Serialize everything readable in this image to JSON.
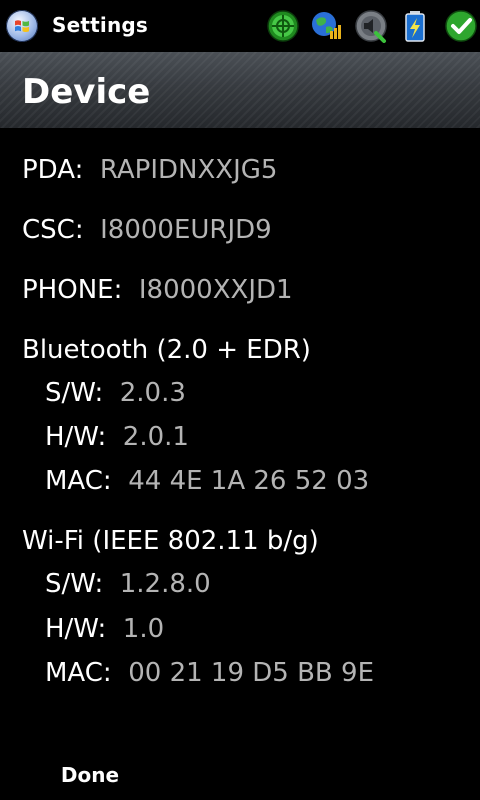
{
  "statusbar": {
    "app_title": "Settings",
    "icons": [
      "start-icon",
      "connectivity-icon",
      "data-connection-icon",
      "volume-icon",
      "battery-icon",
      "ok-icon"
    ]
  },
  "header": {
    "title": "Device"
  },
  "device": {
    "pda_label": "PDA:",
    "pda_value": "RAPIDNXXJG5",
    "csc_label": "CSC:",
    "csc_value": "I8000EURJD9",
    "phone_label": "PHONE:",
    "phone_value": "I8000XXJD1"
  },
  "bluetooth": {
    "title": "Bluetooth (2.0 + EDR)",
    "sw_label": "S/W:",
    "sw_value": "2.0.3",
    "hw_label": "H/W:",
    "hw_value": "2.0.1",
    "mac_label": "MAC:",
    "mac_value": "44 4E 1A 26 52 03"
  },
  "wifi": {
    "title": "Wi-Fi (IEEE 802.11 b/g)",
    "sw_label": "S/W:",
    "sw_value": "1.2.8.0",
    "hw_label": "H/W:",
    "hw_value": "1.0",
    "mac_label": "MAC:",
    "mac_value": "00 21 19 D5 BB 9E"
  },
  "softkeys": {
    "left_label": "Done"
  },
  "colors": {
    "background": "#000000",
    "label": "#ffffff",
    "value": "#b4b4b4",
    "header_band": "#3a3e43"
  }
}
